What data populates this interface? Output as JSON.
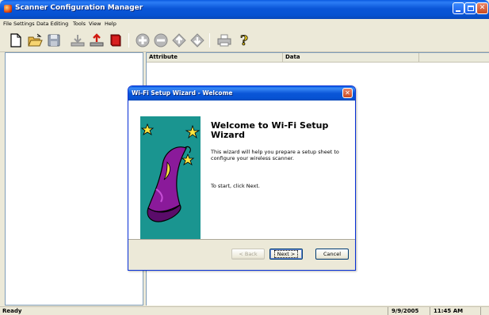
{
  "window": {
    "title": "Scanner Configuration Manager",
    "controls": {
      "minimize": "",
      "maximize": "",
      "close": "✕"
    }
  },
  "menu": [
    "File",
    "Settings",
    "Data Editing",
    "Tools",
    "View",
    "Help"
  ],
  "toolbar": {
    "icons": [
      "new-document",
      "open-folder",
      "save",
      "import-tray",
      "export-tray",
      "book",
      "add",
      "remove",
      "move-up",
      "move-down",
      "print",
      "help"
    ]
  },
  "list": {
    "columns": [
      "Attribute",
      "Data"
    ]
  },
  "status": {
    "text": "Ready",
    "date": "9/9/2005",
    "time": "11:45 AM"
  },
  "dialog": {
    "title": "Wi-Fi Setup Wizard - Welcome",
    "close": "✕",
    "heading": "Welcome to Wi-Fi Setup Wizard",
    "description": "This wizard will help you prepare a setup sheet to configure your wireless scanner.",
    "instruction": "To start, click Next.",
    "buttons": {
      "back": "< Back",
      "next": "Next >",
      "cancel": "Cancel"
    },
    "art_color": "#1a9590"
  },
  "colors": {
    "titlebar": "#0a56d8",
    "window_bg": "#ece9d8",
    "close_button": "#c84a22"
  }
}
